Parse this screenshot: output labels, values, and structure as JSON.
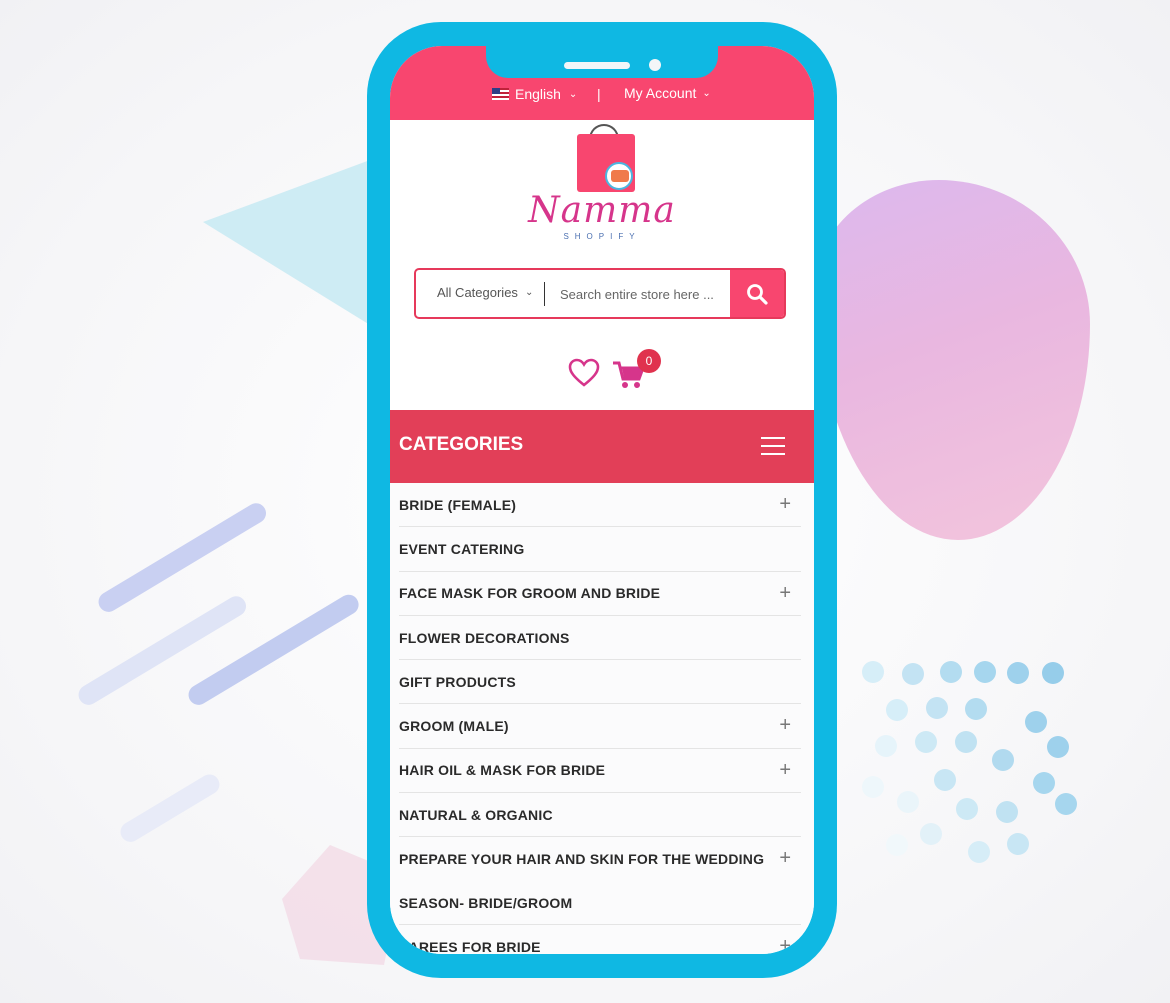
{
  "topbar": {
    "language": "English",
    "separator": "|",
    "account": "My Account"
  },
  "brand": {
    "name": "Namma",
    "sub": "SHOPIFY"
  },
  "search": {
    "category": "All Categories",
    "placeholder": "Search entire store here ..."
  },
  "cart": {
    "count": "0"
  },
  "categories": {
    "title": "CATEGORIES",
    "items": [
      {
        "label": "BRIDE (FEMALE)",
        "plus": "+"
      },
      {
        "label": "EVENT CATERING",
        "plus": ""
      },
      {
        "label": "FACE MASK FOR GROOM AND BRIDE",
        "plus": "+"
      },
      {
        "label": "FLOWER DECORATIONS",
        "plus": ""
      },
      {
        "label": "GIFT PRODUCTS",
        "plus": ""
      },
      {
        "label": "GROOM (MALE)",
        "plus": "+"
      },
      {
        "label": "HAIR OIL & MASK FOR BRIDE",
        "plus": "+"
      },
      {
        "label": "NATURAL & ORGANIC",
        "plus": ""
      },
      {
        "label": "PREPARE YOUR HAIR AND SKIN FOR THE WEDDING SEASON- BRIDE/GROOM",
        "plus": "+"
      },
      {
        "label": "SAREES FOR BRIDE",
        "plus": "+"
      }
    ]
  },
  "colors": {
    "accent": "#f8466f",
    "header": "#e23f58",
    "phone": "#0fb8e3"
  }
}
